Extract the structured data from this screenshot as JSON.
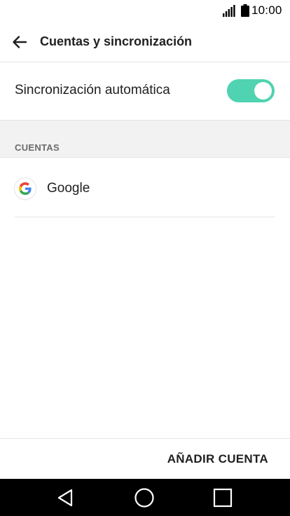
{
  "status_bar": {
    "time": "10:00",
    "icons": [
      "signal-icon",
      "battery-icon"
    ]
  },
  "app_bar": {
    "title": "Cuentas y sincronización",
    "back_icon": "arrow-left-icon"
  },
  "auto_sync": {
    "label": "Sincronización automática",
    "enabled": true,
    "toggle_color": "#4fd3b0"
  },
  "accounts_section": {
    "title": "CUENTAS",
    "items": [
      {
        "name": "Google",
        "icon": "google-logo-icon"
      }
    ]
  },
  "actions": {
    "add_account_label": "AÑADIR CUENTA"
  },
  "nav_bar": {
    "buttons": [
      "back-triangle-icon",
      "home-circle-icon",
      "recent-square-icon"
    ]
  }
}
